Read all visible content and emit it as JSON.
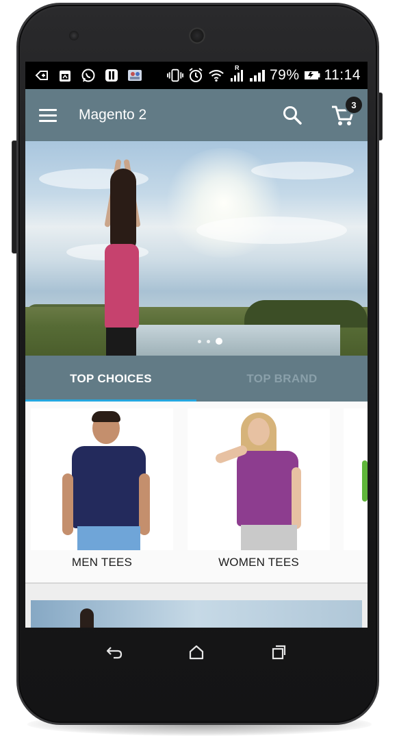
{
  "status_bar": {
    "battery_percent": "79%",
    "time": "11:14",
    "notification_icons": [
      "notification-icon",
      "calendar-icon",
      "whatsapp-icon",
      "app-icon",
      "contacts-icon"
    ],
    "system_icons": [
      "vibrate-icon",
      "alarm-icon",
      "wifi-icon",
      "signal-icon",
      "battery-icon"
    ],
    "roaming_label": "R"
  },
  "toolbar": {
    "title": "Magento 2",
    "cart_count": "3",
    "icons": [
      "menu-icon",
      "search-icon",
      "cart-icon"
    ]
  },
  "banner": {
    "slide_count": 3,
    "active_slide": 3
  },
  "tabs": [
    {
      "label": "TOP CHOICES",
      "active": true
    },
    {
      "label": "TOP BRAND",
      "active": false
    }
  ],
  "products": [
    {
      "label": "MEN TEES"
    },
    {
      "label": "WOMEN TEES"
    }
  ],
  "nav_bar": {
    "icons": [
      "back-icon",
      "home-icon",
      "recents-icon"
    ]
  },
  "colors": {
    "toolbar": "#627b86",
    "tab_indicator": "#25a7e0",
    "status_bar": "#000000"
  }
}
